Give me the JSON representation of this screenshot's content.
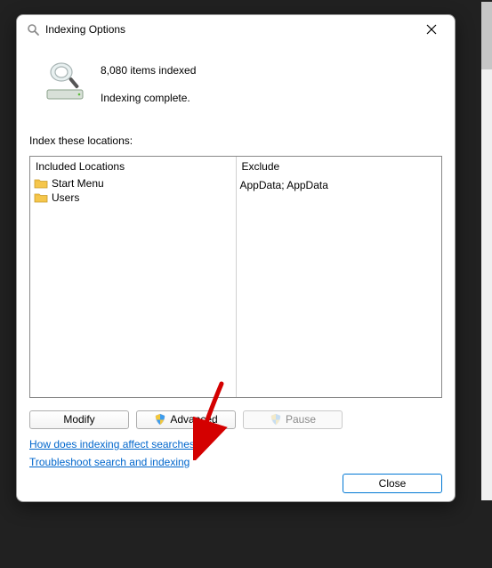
{
  "dialog": {
    "title": "Indexing Options",
    "status_count": "8,080 items indexed",
    "status_state": "Indexing complete.",
    "section_label": "Index these locations:",
    "columns": {
      "included_header": "Included Locations",
      "exclude_header": "Exclude"
    },
    "included_items": [
      "Start Menu",
      "Users"
    ],
    "exclude_items": [
      "",
      "AppData; AppData"
    ],
    "buttons": {
      "modify": "Modify",
      "advanced": "Advanced",
      "pause": "Pause",
      "close": "Close"
    },
    "links": {
      "how": "How does indexing affect searches?",
      "troubleshoot": "Troubleshoot search and indexing"
    }
  }
}
